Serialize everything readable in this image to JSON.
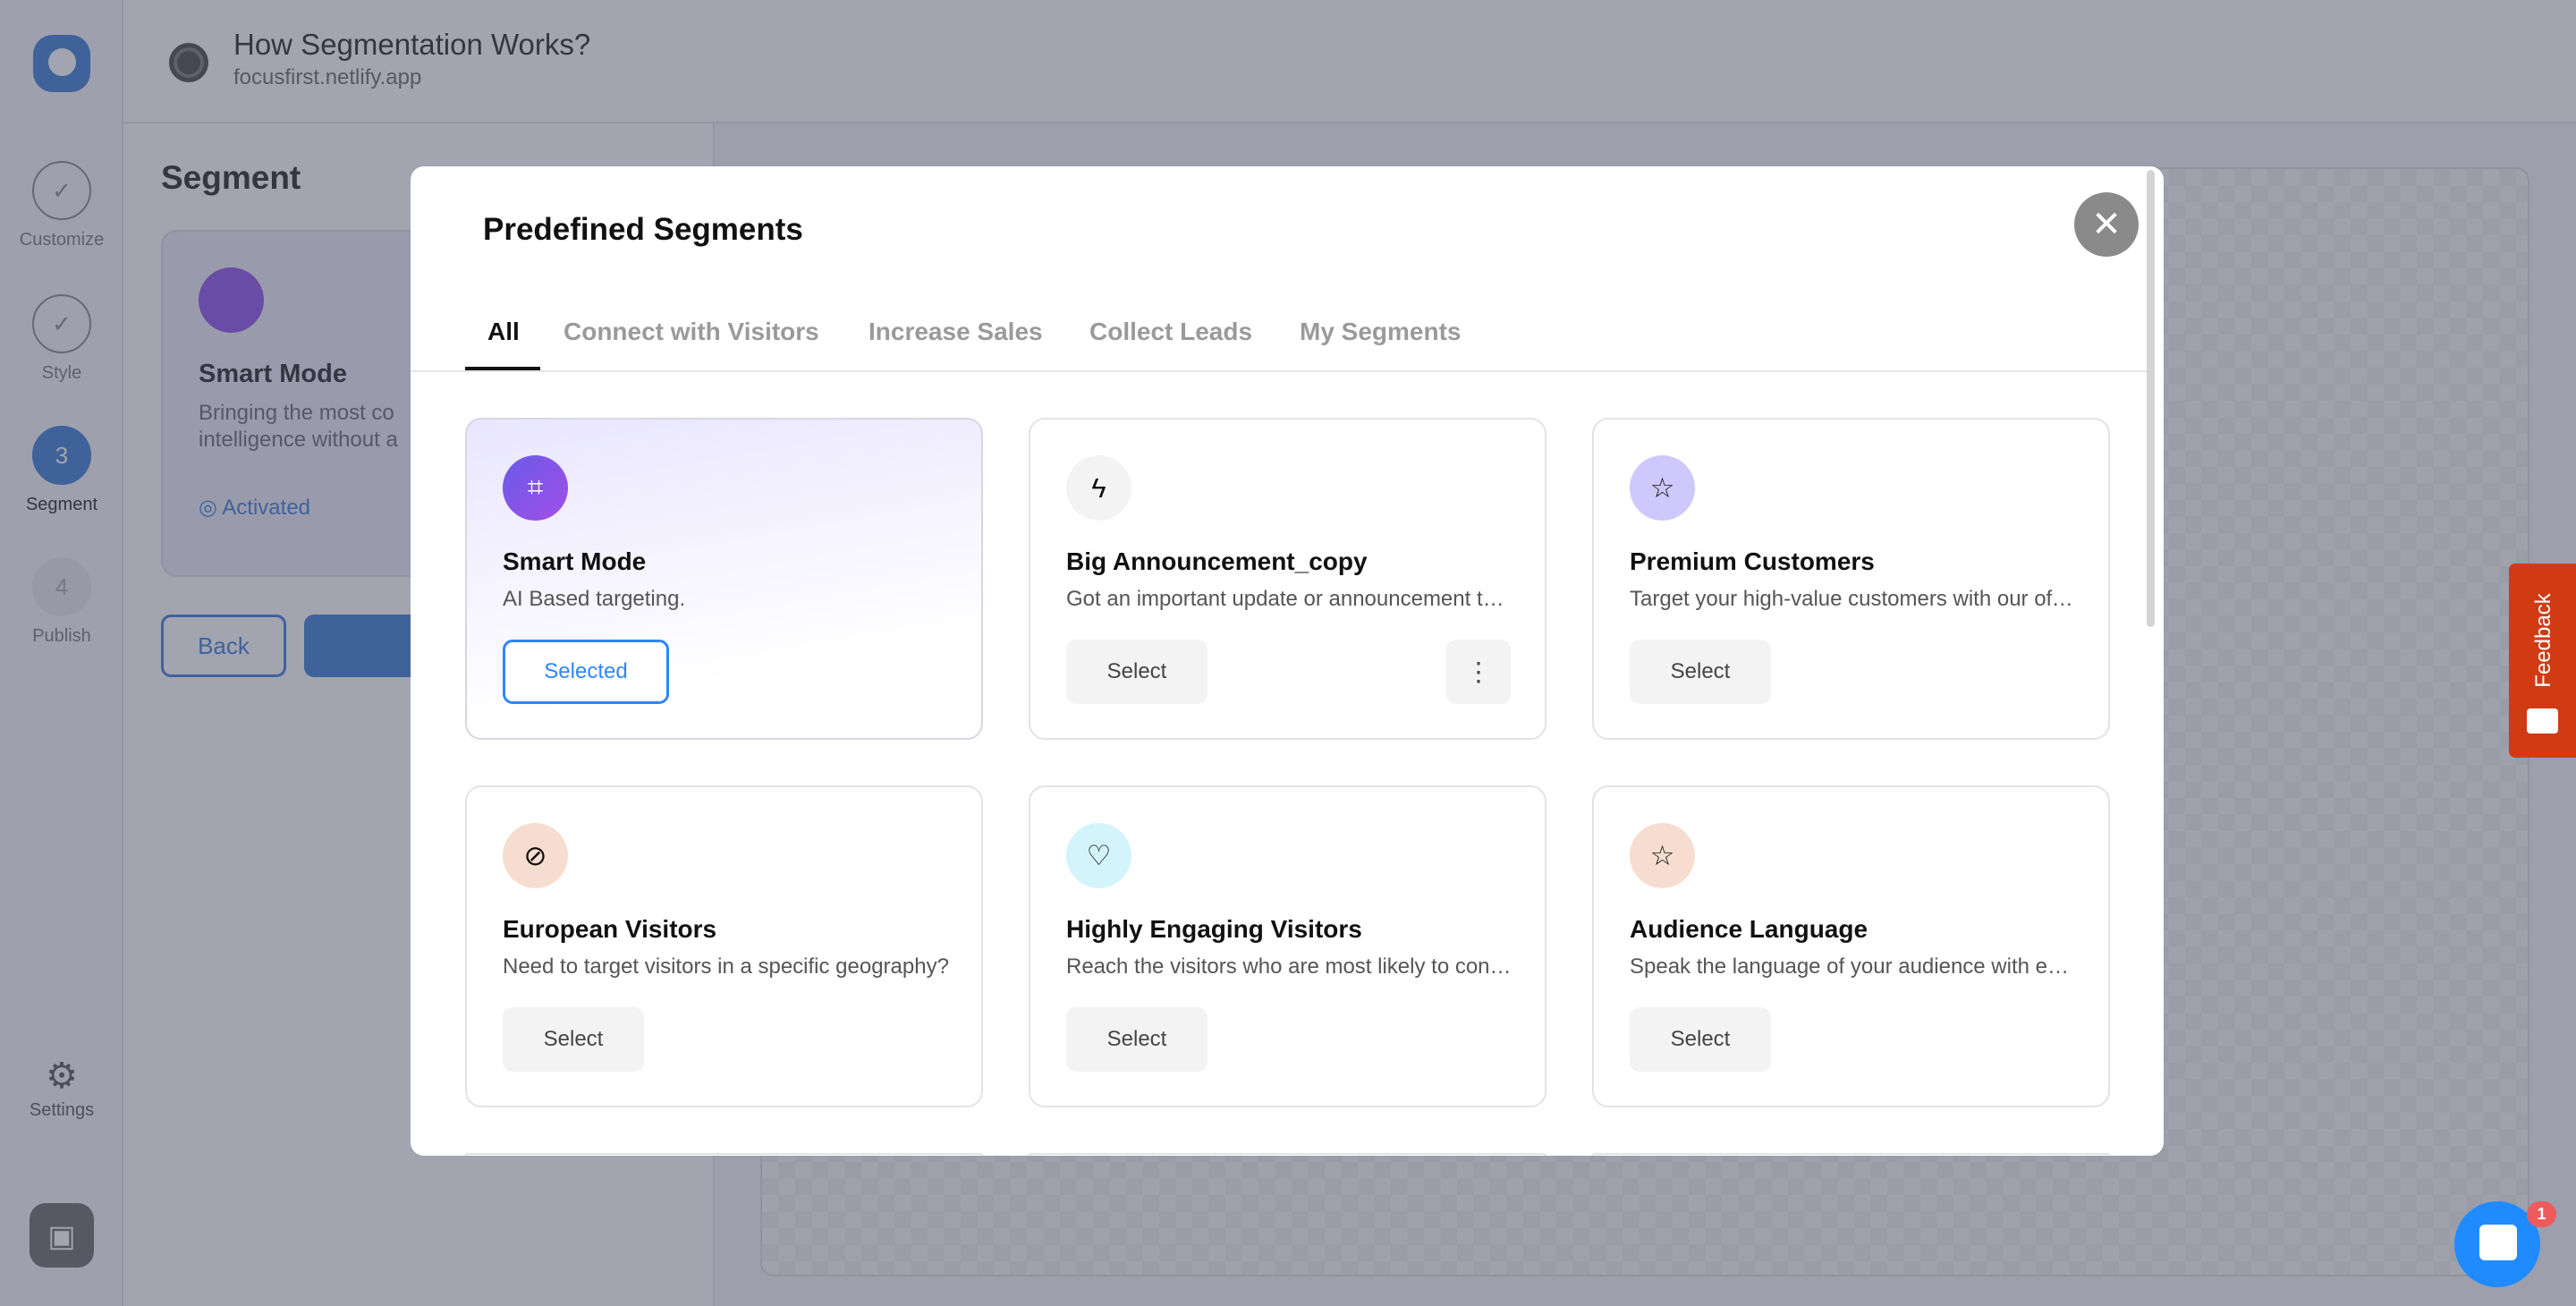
{
  "header": {
    "title": "How Segmentation Works?",
    "subtitle": "focusfirst.netlify.app"
  },
  "rail": {
    "steps": [
      {
        "label": "Customize"
      },
      {
        "label": "Style"
      },
      {
        "label": "Segment",
        "number": "3"
      },
      {
        "label": "Publish",
        "number": "4"
      }
    ],
    "settings": "Settings"
  },
  "panel": {
    "title": "Segment",
    "card_title": "Smart Mode",
    "card_desc_1": "Bringing the most co",
    "card_desc_2": "intelligence without a",
    "status": "Activated",
    "back": "Back"
  },
  "modal": {
    "title": "Predefined Segments",
    "tabs": [
      "All",
      "Connect with Visitors",
      "Increase Sales",
      "Collect Leads",
      "My Segments"
    ],
    "cards": [
      {
        "title": "Smart Mode",
        "desc": "AI Based targeting.",
        "button": "Selected",
        "icon": "smart-frame-icon",
        "color": "#8b4fe8"
      },
      {
        "title": "Big Announcement_copy",
        "desc": "Got an important update or announcement to share?",
        "button": "Select",
        "icon": "lightning-icon",
        "color": "#f3f3f4"
      },
      {
        "title": "Premium Customers",
        "desc": "Target your high-value customers with our offers",
        "button": "Select",
        "icon": "star-icon",
        "color": "#cfc8fd"
      },
      {
        "title": "European Visitors",
        "desc": "Need to target visitors in a specific geography?",
        "button": "Select",
        "icon": "compass-icon",
        "color": "#f7ddd0"
      },
      {
        "title": "Highly Engaging Visitors",
        "desc": "Reach the visitors who are most likely to convert",
        "button": "Select",
        "icon": "heart-icon",
        "color": "#d4f4fb"
      },
      {
        "title": "Audience Language",
        "desc": "Speak the language of your audience with ease",
        "button": "Select",
        "icon": "star-icon",
        "color": "#f7ddd0"
      }
    ]
  },
  "feedback": "Feedback",
  "chat": {
    "badge": "1"
  },
  "colors": {
    "accent": "#3a7bd5",
    "feedback": "#d13b14",
    "chat": "#1f8bff"
  }
}
